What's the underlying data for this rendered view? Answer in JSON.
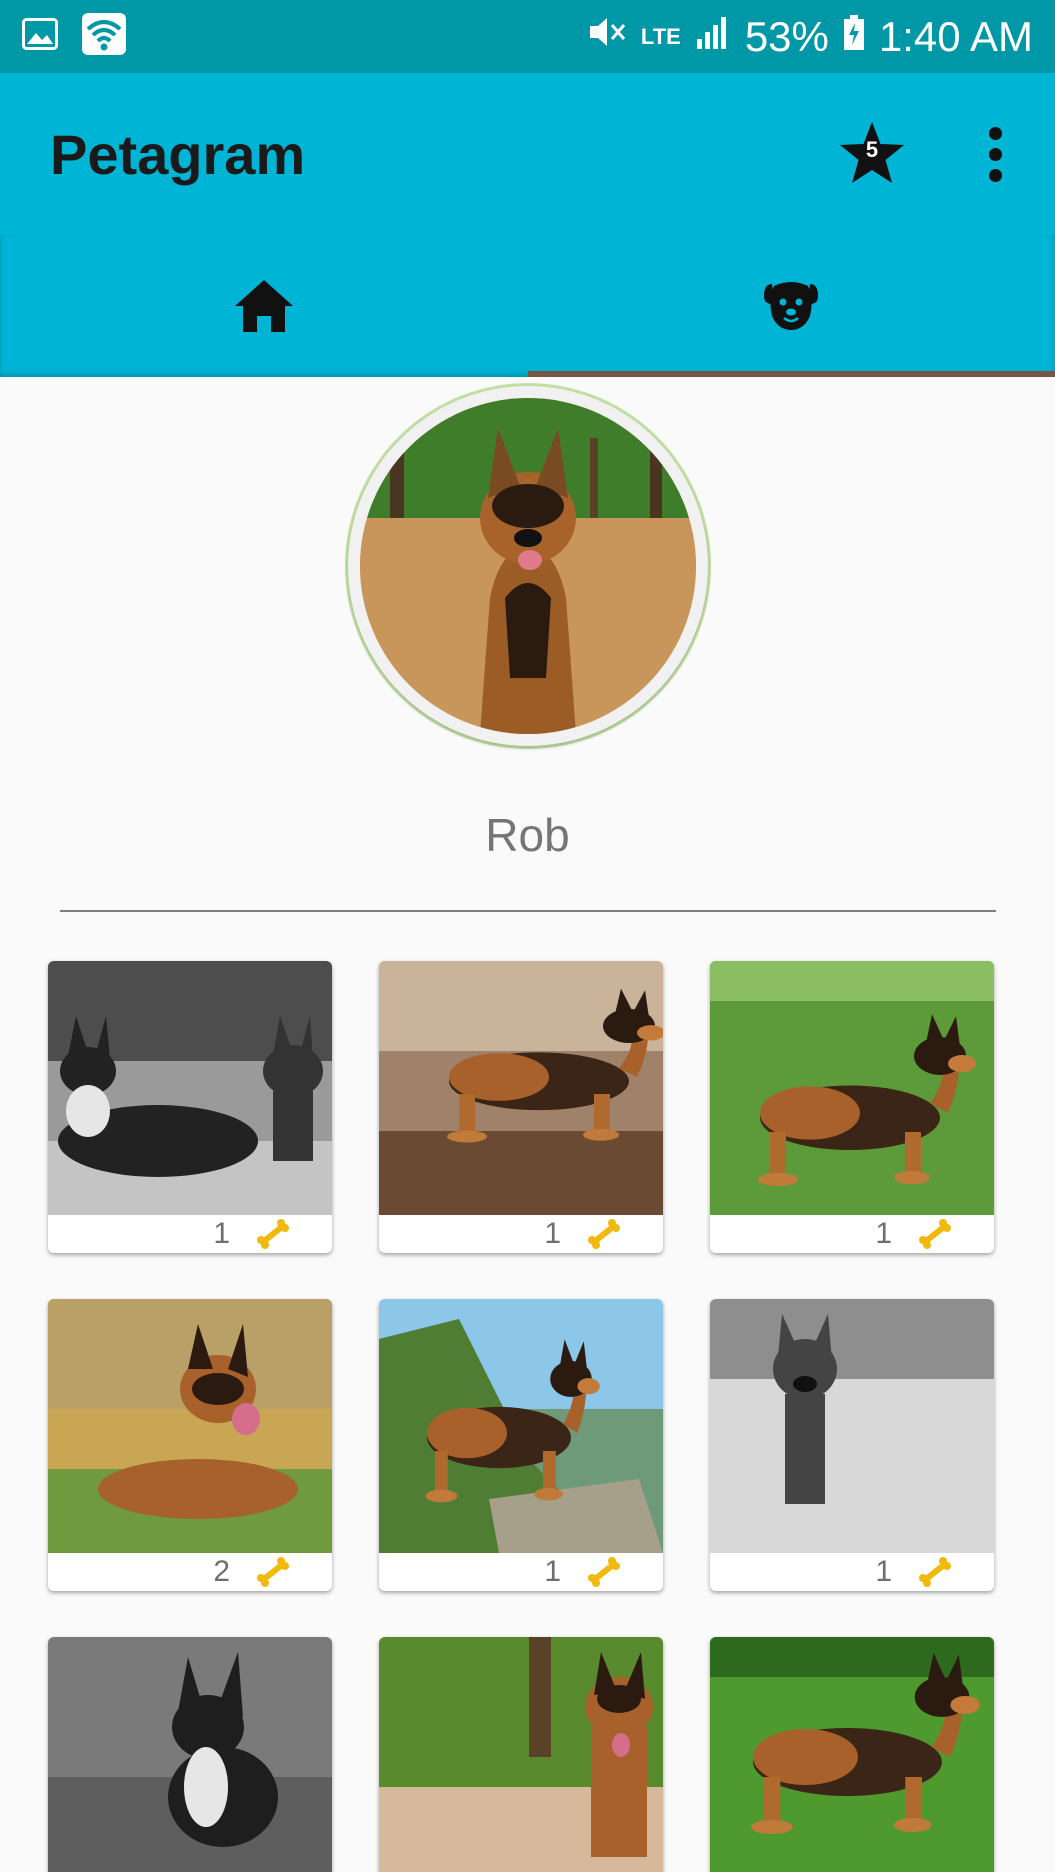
{
  "status_bar": {
    "network": "LTE",
    "battery_percent": "53%",
    "time": "1:40 AM",
    "icons": [
      "image-icon",
      "wifi-icon",
      "mute-icon",
      "signal-icon",
      "battery-charging-icon"
    ]
  },
  "app_bar": {
    "title": "Petagram",
    "favorites_badge": "5",
    "icons": [
      "star-icon",
      "more-vert-icon"
    ]
  },
  "tabs": [
    {
      "icon": "home-icon",
      "active": false
    },
    {
      "icon": "dog-icon",
      "active": true
    }
  ],
  "profile": {
    "name": "Rob"
  },
  "photos": [
    {
      "likes": "1",
      "tone": "grayscale"
    },
    {
      "likes": "1",
      "tone": "autumn"
    },
    {
      "likes": "1",
      "tone": "grass"
    },
    {
      "likes": "2",
      "tone": "warm"
    },
    {
      "likes": "1",
      "tone": "sky"
    },
    {
      "likes": "1",
      "tone": "grayscale"
    },
    {
      "likes": "",
      "tone": "grayscale"
    },
    {
      "likes": "",
      "tone": "path"
    },
    {
      "likes": "",
      "tone": "grass"
    }
  ],
  "colors": {
    "status_bar": "#0097a7",
    "app_bar": "#00b4d5",
    "tab_indicator": "#795548",
    "bone": "#f0b90b"
  }
}
